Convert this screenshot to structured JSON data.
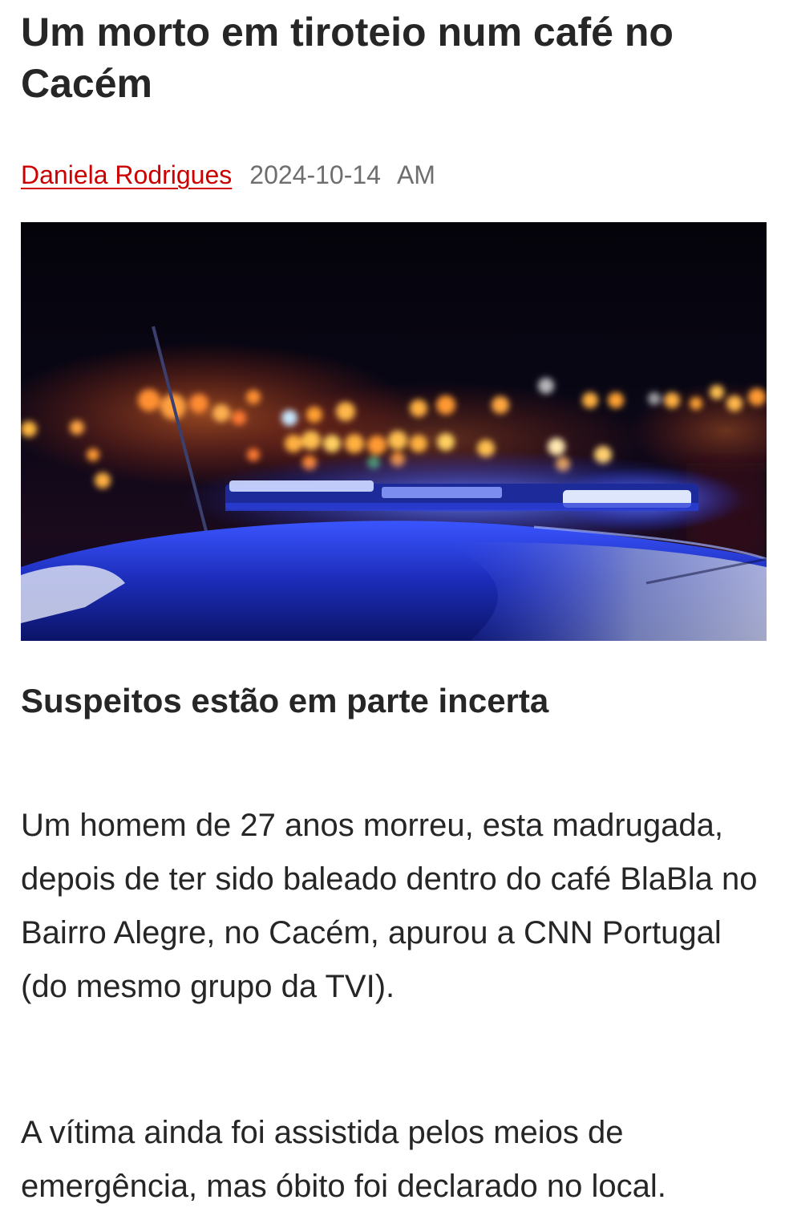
{
  "article": {
    "headline": "Um morto em tiroteio num café no Cacém",
    "author": "Daniela Rodrigues",
    "date": "2024-10-14",
    "time": "AM",
    "subheadline": "Suspeitos estão em parte incerta",
    "paragraphs": [
      "Um homem de 27 anos morreu, esta madrugada, depois de ter sido baleado dentro do café BlaBla no Bairro Alegre, no Cacém, apurou a CNN Portugal (do mesmo grupo da TVI).",
      "A vítima ainda foi assistida pelos meios de emergência, mas óbito foi declarado no local."
    ]
  },
  "colors": {
    "headline_text": "#262626",
    "author_link": "#cc0000",
    "meta_text": "#6e6e6e",
    "photo_background": "#05040d",
    "siren_blue": "#2a4dff"
  }
}
